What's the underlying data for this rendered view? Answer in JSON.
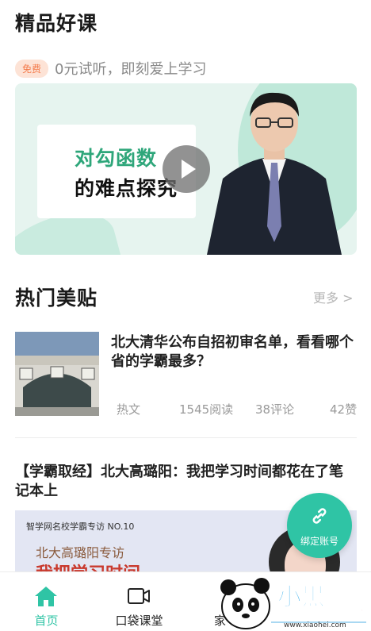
{
  "courses": {
    "title": "精品好课",
    "free_badge": "免费",
    "subtitle": "0元试听，即刻爱上学习",
    "banner": {
      "line1": "对勾函数",
      "line2": "的难点探究"
    }
  },
  "posts": {
    "title": "热门美贴",
    "more": "更多 >"
  },
  "articles": [
    {
      "title": "北大清华公布自招初审名单，看看哪个省的学霸最多？",
      "tag": "热文",
      "reads": "1545阅读",
      "comments": "38评论",
      "likes": "42赞"
    },
    {
      "title": "【学霸取经】北大高璐阳：我把学习时间都花在了笔记本上",
      "image_small": "智学网名校学霸专访 NO.10",
      "image_sub": "北大高璐阳专访",
      "image_big": "我把学习时间"
    }
  ],
  "float_button": {
    "label": "绑定账号"
  },
  "tabs": [
    {
      "label": "首页",
      "icon": "home-icon",
      "active": true
    },
    {
      "label": "口袋课堂",
      "icon": "video-camera-icon",
      "active": false
    },
    {
      "label": "家",
      "icon": "family-icon",
      "active": false
    },
    {
      "label": "",
      "icon": "profile-icon",
      "active": false
    }
  ],
  "watermark": {
    "text": "小黑游戏",
    "url": "www.xiaohei.com"
  },
  "colors": {
    "accent": "#2fc4a5",
    "badge_bg": "#fde3d6",
    "badge_text": "#f47c4c",
    "banner_green": "#2ea67a"
  }
}
